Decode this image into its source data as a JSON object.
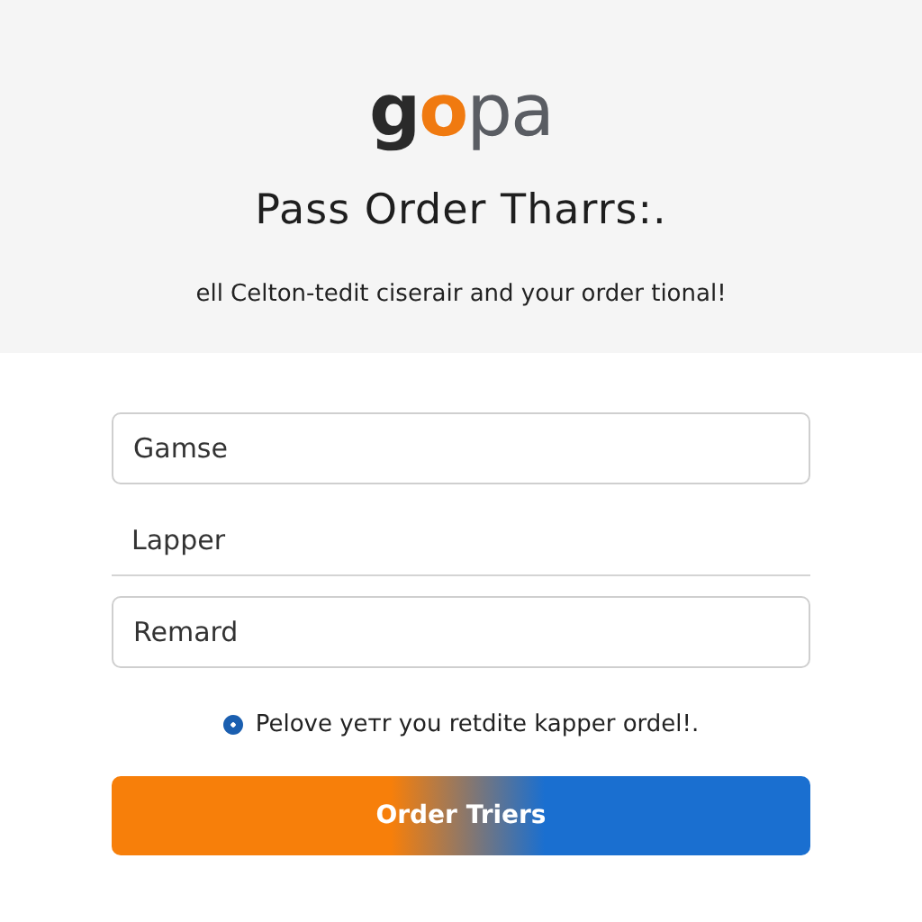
{
  "logo": [
    {
      "text": "g",
      "color": "#2a2a2a"
    },
    {
      "text": "o",
      "color": "#f07a10"
    },
    {
      "text": "pa",
      "color": "#5a5d63"
    }
  ],
  "title": "Pass Order Tharrs:.",
  "subtitle": "ell Celton-tedit ciserair and your order tional!",
  "fields": [
    {
      "kind": "boxed",
      "value": "Gamse"
    },
    {
      "kind": "underline",
      "value": "Lapper"
    },
    {
      "kind": "boxed",
      "value": "Remard"
    }
  ],
  "agree": {
    "checked": true,
    "label": "Pelove yeтr you retdite kapper ordel!."
  },
  "button": "Order Triers"
}
